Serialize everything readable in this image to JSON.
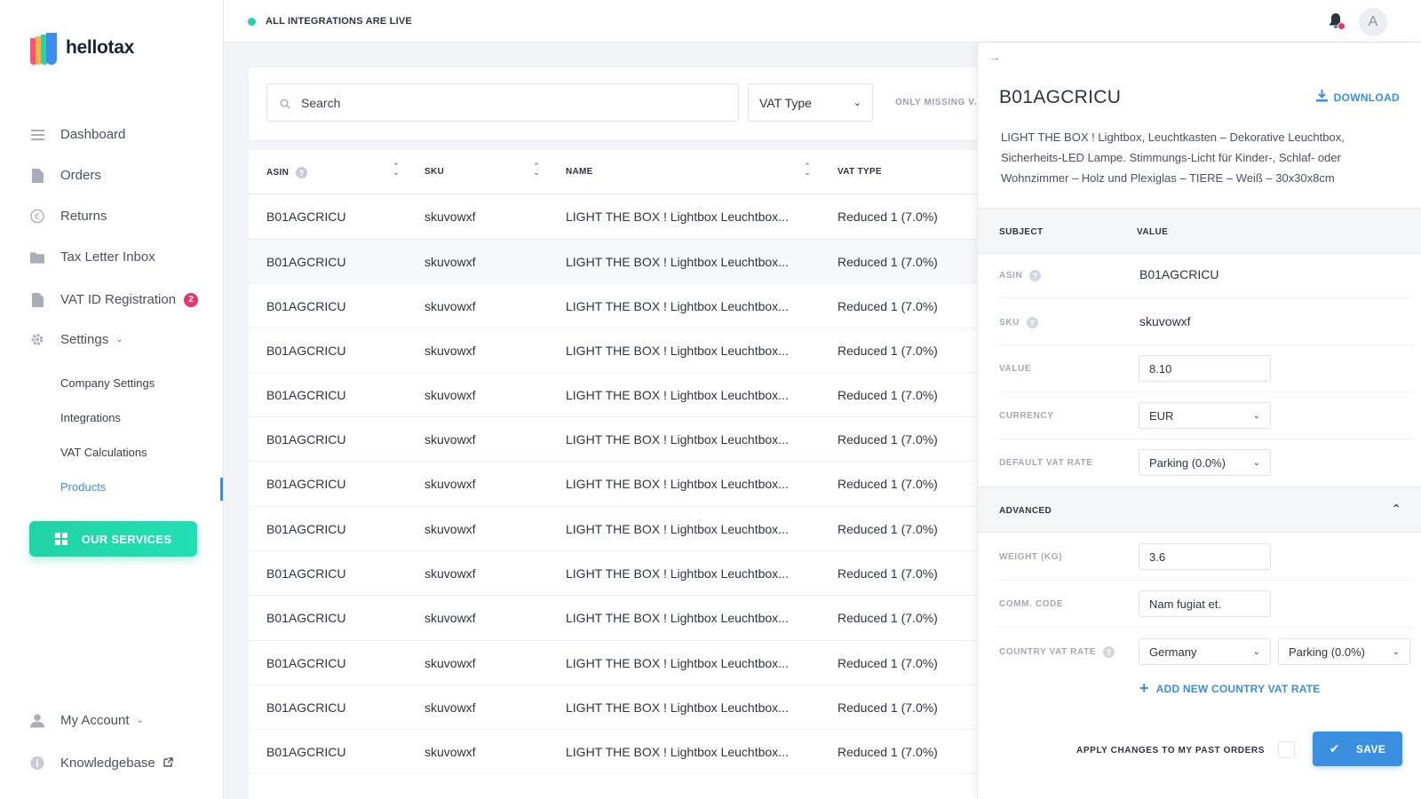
{
  "app": {
    "name": "hellotax"
  },
  "status": {
    "text": "ALL INTEGRATIONS ARE LIVE"
  },
  "user": {
    "initial": "A"
  },
  "sidebar": {
    "items": [
      {
        "label": "Dashboard",
        "icon": "menu-icon"
      },
      {
        "label": "Orders",
        "icon": "document-icon"
      },
      {
        "label": "Returns",
        "icon": "euro-icon"
      },
      {
        "label": "Tax Letter Inbox",
        "icon": "folder-icon"
      },
      {
        "label": "VAT ID Registration",
        "icon": "file-icon",
        "badge": "2"
      },
      {
        "label": "Settings",
        "icon": "gear-icon"
      }
    ],
    "settings_sub": [
      {
        "label": "Company Settings"
      },
      {
        "label": "Integrations"
      },
      {
        "label": "VAT Calculations"
      },
      {
        "label": "Products",
        "active": true
      }
    ],
    "services_button": "OUR SERVICES",
    "bottom": [
      {
        "label": "My Account",
        "icon": "user-icon"
      },
      {
        "label": "Knowledgebase",
        "icon": "info-icon"
      }
    ]
  },
  "filters": {
    "search_placeholder": "Search",
    "vat_type": "VAT Type",
    "only_missing": "ONLY MISSING V..."
  },
  "table": {
    "columns": [
      "ASIN",
      "SKU",
      "NAME",
      "VAT TYPE"
    ],
    "rows": [
      {
        "asin": "B01AGCRICU",
        "sku": "skuvowxf",
        "name": "LIGHT THE BOX ! Lightbox Leuchtbox...",
        "vat_type": "Reduced 1 (7.0%)"
      },
      {
        "asin": "B01AGCRICU",
        "sku": "skuvowxf",
        "name": "LIGHT THE BOX ! Lightbox Leuchtbox...",
        "vat_type": "Reduced 1 (7.0%)"
      },
      {
        "asin": "B01AGCRICU",
        "sku": "skuvowxf",
        "name": "LIGHT THE BOX ! Lightbox Leuchtbox...",
        "vat_type": "Reduced 1 (7.0%)"
      },
      {
        "asin": "B01AGCRICU",
        "sku": "skuvowxf",
        "name": "LIGHT THE BOX ! Lightbox Leuchtbox...",
        "vat_type": "Reduced 1 (7.0%)"
      },
      {
        "asin": "B01AGCRICU",
        "sku": "skuvowxf",
        "name": "LIGHT THE BOX ! Lightbox Leuchtbox...",
        "vat_type": "Reduced 1 (7.0%)"
      },
      {
        "asin": "B01AGCRICU",
        "sku": "skuvowxf",
        "name": "LIGHT THE BOX ! Lightbox Leuchtbox...",
        "vat_type": "Reduced 1 (7.0%)"
      },
      {
        "asin": "B01AGCRICU",
        "sku": "skuvowxf",
        "name": "LIGHT THE BOX ! Lightbox Leuchtbox...",
        "vat_type": "Reduced 1 (7.0%)"
      },
      {
        "asin": "B01AGCRICU",
        "sku": "skuvowxf",
        "name": "LIGHT THE BOX ! Lightbox Leuchtbox...",
        "vat_type": "Reduced 1 (7.0%)"
      },
      {
        "asin": "B01AGCRICU",
        "sku": "skuvowxf",
        "name": "LIGHT THE BOX ! Lightbox Leuchtbox...",
        "vat_type": "Reduced 1 (7.0%)"
      },
      {
        "asin": "B01AGCRICU",
        "sku": "skuvowxf",
        "name": "LIGHT THE BOX ! Lightbox Leuchtbox...",
        "vat_type": "Reduced 1 (7.0%)"
      },
      {
        "asin": "B01AGCRICU",
        "sku": "skuvowxf",
        "name": "LIGHT THE BOX ! Lightbox Leuchtbox...",
        "vat_type": "Reduced 1 (7.0%)"
      },
      {
        "asin": "B01AGCRICU",
        "sku": "skuvowxf",
        "name": "LIGHT THE BOX ! Lightbox Leuchtbox...",
        "vat_type": "Reduced 1 (7.0%)"
      },
      {
        "asin": "B01AGCRICU",
        "sku": "skuvowxf",
        "name": "LIGHT THE BOX ! Lightbox Leuchtbox...",
        "vat_type": "Reduced 1 (7.0%)"
      }
    ]
  },
  "panel": {
    "title": "B01AGCRICU",
    "download": "DOWNLOAD",
    "description": "LIGHT THE BOX ! Lightbox, Leuchtkasten – Dekorative Leuchtbox, Sicherheits-LED Lampe. Stimmungs-Licht für Kinder-, Schlaf- oder Wohnzimmer – Holz und Plexiglas – TIERE – Weiß – 30x30x8cm",
    "subject_header": "SUBJECT",
    "value_header": "VALUE",
    "fields": {
      "asin": {
        "label": "ASIN",
        "value": "B01AGCRICU"
      },
      "sku": {
        "label": "SKU",
        "value": "skuvowxf"
      },
      "value": {
        "label": "VALUE",
        "value": "8.10"
      },
      "currency": {
        "label": "CURRENCY",
        "value": "EUR"
      },
      "default_vat": {
        "label": "DEFAULT VAT RATE",
        "value": "Parking (0.0%)"
      }
    },
    "advanced": {
      "header": "ADVANCED",
      "weight": {
        "label": "WEIGHT (KG)",
        "value": "3.6"
      },
      "comm_code": {
        "label": "COMM. CODE",
        "value": "Nam fugiat et."
      },
      "country_vat": {
        "label": "COUNTRY VAT RATE",
        "country": "Germany",
        "rate": "Parking (0.0%)"
      },
      "add_rate": "ADD NEW COUNTRY VAT RATE"
    },
    "apply_label": "APPLY CHANGES TO MY PAST ORDERS",
    "save": "SAVE"
  },
  "colors": {
    "accent": "#3b8fe0",
    "brand_green": "#22d3a6",
    "badge": "#e8336e"
  }
}
